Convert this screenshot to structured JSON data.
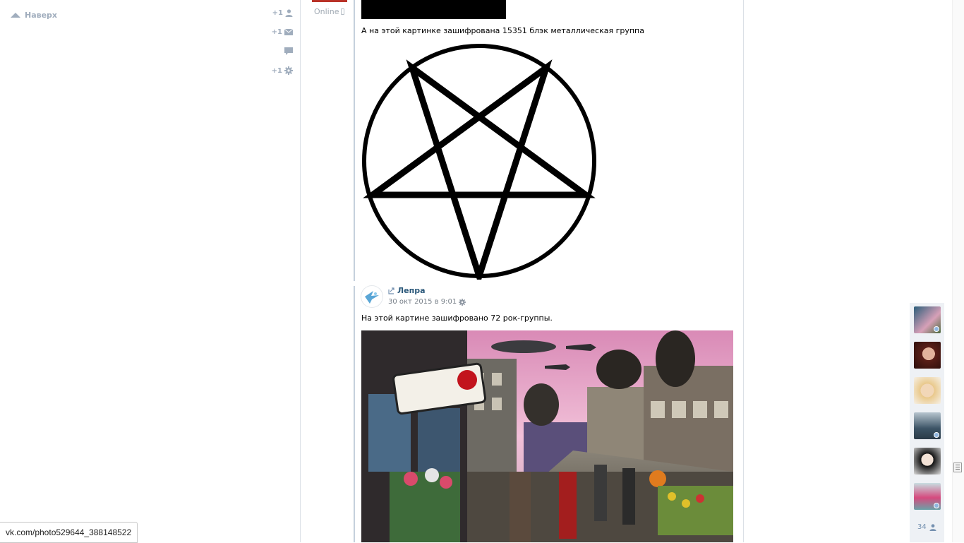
{
  "left_panel": {
    "to_top_label": "Наверх",
    "quick_actions": [
      {
        "label": "+1",
        "icon": "person-icon"
      },
      {
        "label": "+1",
        "icon": "envelope-icon"
      },
      {
        "label": "",
        "icon": "comment-icon"
      },
      {
        "label": "+1",
        "icon": "gear-icon"
      }
    ]
  },
  "author": {
    "online_label": "Online"
  },
  "post": {
    "caption": "А на этой картинке зашифрована 15351 блэк металлическая группа"
  },
  "repost": {
    "author_name": "Лепра",
    "date": "30 окт 2015 в 9:01",
    "caption": "На этой картине зашифровано 72 рок-группы."
  },
  "friends": {
    "count": "34"
  },
  "status_bar": {
    "url": "vk.com/photo529644_388148522"
  },
  "colors": {
    "link": "#2b587a",
    "muted": "#a0adbd",
    "divider": "#dbe0e6"
  }
}
